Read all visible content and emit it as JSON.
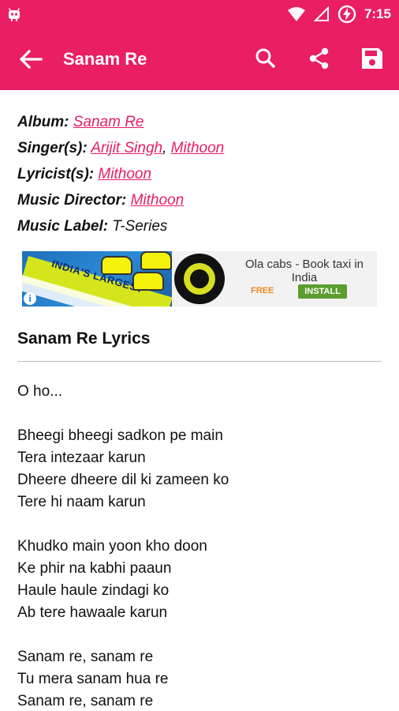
{
  "status_bar": {
    "time": "7:15",
    "icons": [
      "android-debug-icon",
      "wifi-icon",
      "signal-icon",
      "battery-charging-icon"
    ]
  },
  "app_bar": {
    "title": "Sanam Re",
    "actions": [
      "search-icon",
      "share-icon",
      "save-icon"
    ]
  },
  "meta": {
    "album_label": "Album:",
    "album": "Sanam Re",
    "singers_label": "Singer(s):",
    "singer_1": "Arijit Singh",
    "singer_sep": ",",
    "singer_2": "Mithoon",
    "lyricists_label": "Lyricist(s):",
    "lyricist": "Mithoon",
    "music_director_label": "Music Director:",
    "music_director": "Mithoon",
    "music_label_label": "Music Label:",
    "music_label": "T-Series"
  },
  "ad": {
    "banner_text": "INDIA'S LARGEST",
    "title": "Ola cabs - Book taxi in India",
    "price": "FREE",
    "cta": "INSTALL"
  },
  "lyrics": {
    "heading": "Sanam Re Lyrics",
    "lines": [
      "O ho...",
      "",
      "Bheegi bheegi sadkon pe main",
      "Tera intezaar karun",
      "Dheere dheere dil ki zameen ko",
      "Tere hi naam karun",
      "",
      "Khudko main yoon kho doon",
      "Ke phir na kabhi paaun",
      "Haule haule zindagi ko",
      "Ab tere hawaale karun",
      "",
      "Sanam re, sanam re",
      "Tu mera sanam hua re",
      "Sanam re, sanam re"
    ]
  },
  "colors": {
    "primary": "#e91e63",
    "link": "#e91e63",
    "text": "#111111"
  }
}
